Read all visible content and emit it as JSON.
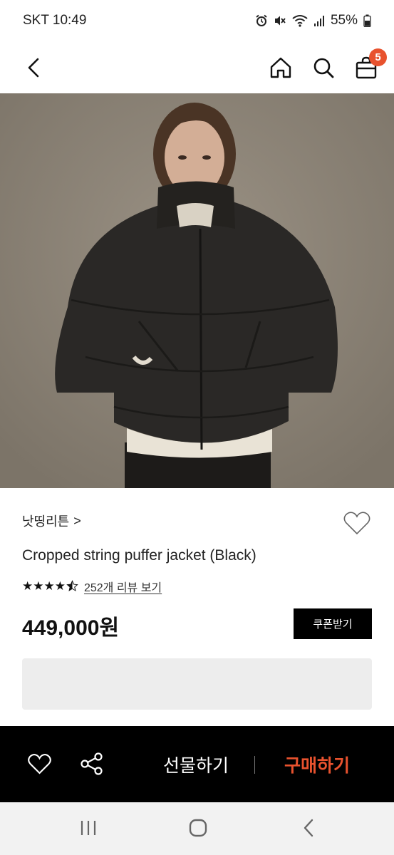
{
  "status_bar": {
    "carrier_time": "SKT 10:49",
    "battery": "55%",
    "icons": [
      "alarm-icon",
      "mute-icon",
      "wifi-icon",
      "signal-icon",
      "battery-icon"
    ]
  },
  "top_nav": {
    "back_icon": "chevron-left-icon",
    "home_icon": "home-icon",
    "search_icon": "search-icon",
    "cart_icon": "shopping-bag-icon",
    "cart_count": "5",
    "accent": "#e8522e"
  },
  "product": {
    "image": "product-photo",
    "brand": "낫띵리튼",
    "brand_chevron": ">",
    "name": "Cropped string puffer jacket (Black)",
    "rating": 4.5,
    "stars": "★★★★",
    "review_link": "252개 리뷰 보기",
    "price": "449,000원",
    "coupon_button": "쿠폰받기",
    "wishlist_icon": "heart-outline-icon"
  },
  "bottom_bar": {
    "like_icon": "heart-outline-icon",
    "share_icon": "share-icon",
    "gift_button": "선물하기",
    "buy_button": "구매하기",
    "buy_color": "#e8522e"
  },
  "system_nav": {
    "recents_icon": "recents-icon",
    "home_icon": "home-circle-icon",
    "back_icon": "back-icon"
  }
}
